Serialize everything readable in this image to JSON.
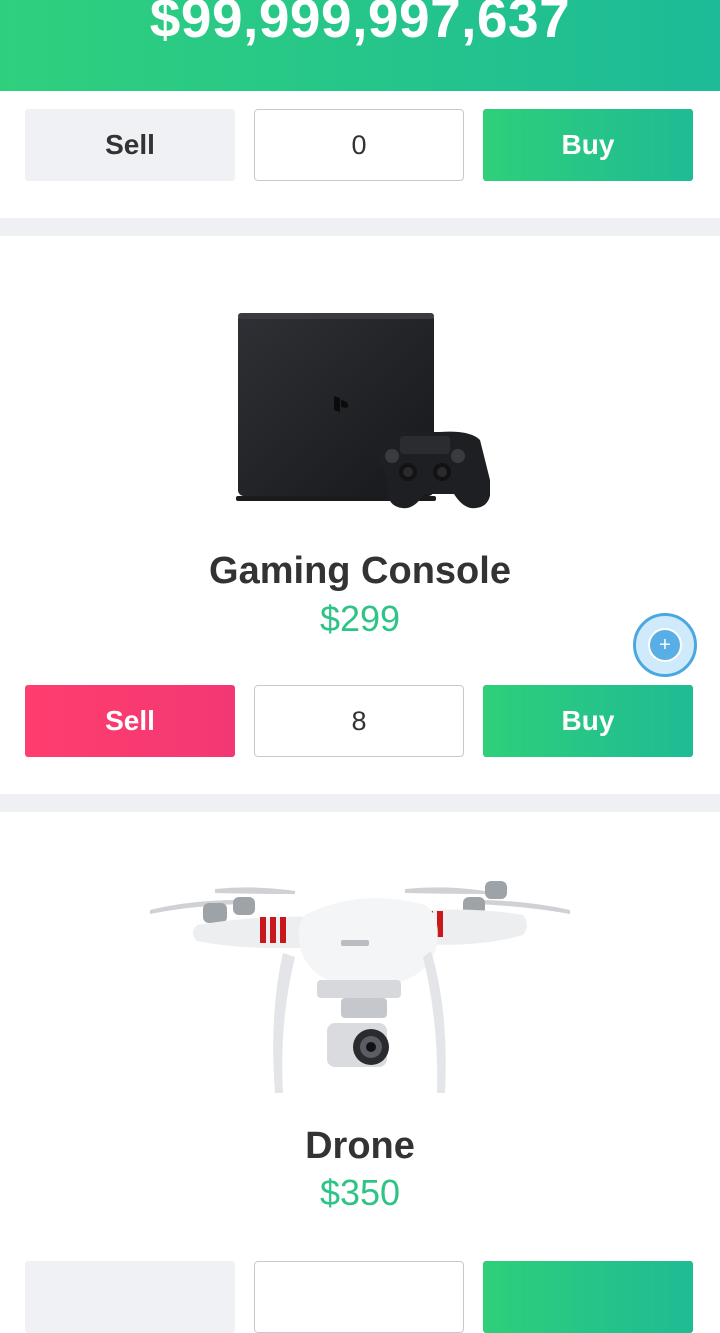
{
  "header": {
    "balance": "$99,999,997,637"
  },
  "top_controls": {
    "sell_label": "Sell",
    "quantity": "0",
    "buy_label": "Buy"
  },
  "products": [
    {
      "name": "Gaming Console",
      "price": "$299",
      "quantity": "8",
      "sell_label": "Sell",
      "buy_label": "Buy",
      "image_icon": "gaming-console-icon"
    },
    {
      "name": "Drone",
      "price": "$350",
      "image_icon": "drone-icon"
    }
  ],
  "floating_button": {
    "icon": "plus-icon",
    "glyph": "+"
  },
  "colors": {
    "accent_green": "#2ec486",
    "sell_pink": "#f23874",
    "separator": "#eff0f4",
    "float_blue": "#4aa8e0"
  }
}
